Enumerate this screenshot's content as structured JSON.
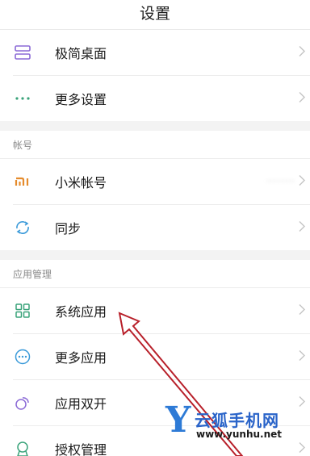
{
  "header": {
    "title": "设置"
  },
  "group1": {
    "items": [
      {
        "label": "极简桌面",
        "icon": "simple-desktop-icon"
      },
      {
        "label": "更多设置",
        "icon": "more-dots-icon"
      }
    ]
  },
  "account": {
    "header": "帐号",
    "items": [
      {
        "label": "小米帐号",
        "value": "·······",
        "icon": "mi-logo-icon"
      },
      {
        "label": "同步",
        "icon": "sync-icon"
      }
    ]
  },
  "apps": {
    "header": "应用管理",
    "items": [
      {
        "label": "系统应用",
        "icon": "grid-apps-icon"
      },
      {
        "label": "更多应用",
        "icon": "more-circle-icon"
      },
      {
        "label": "应用双开",
        "icon": "dual-apps-icon"
      },
      {
        "label": "授权管理",
        "icon": "permission-icon"
      }
    ]
  },
  "watermark": {
    "letter": "Y",
    "name": "云狐手机网",
    "url": "www.yunhu.net"
  },
  "colors": {
    "accent_green": "#3aa37a",
    "mi_orange": "#e58b2c",
    "sync_blue": "#3a9ad9",
    "purple": "#8b6ad6",
    "arrow_red": "#b8202a"
  }
}
